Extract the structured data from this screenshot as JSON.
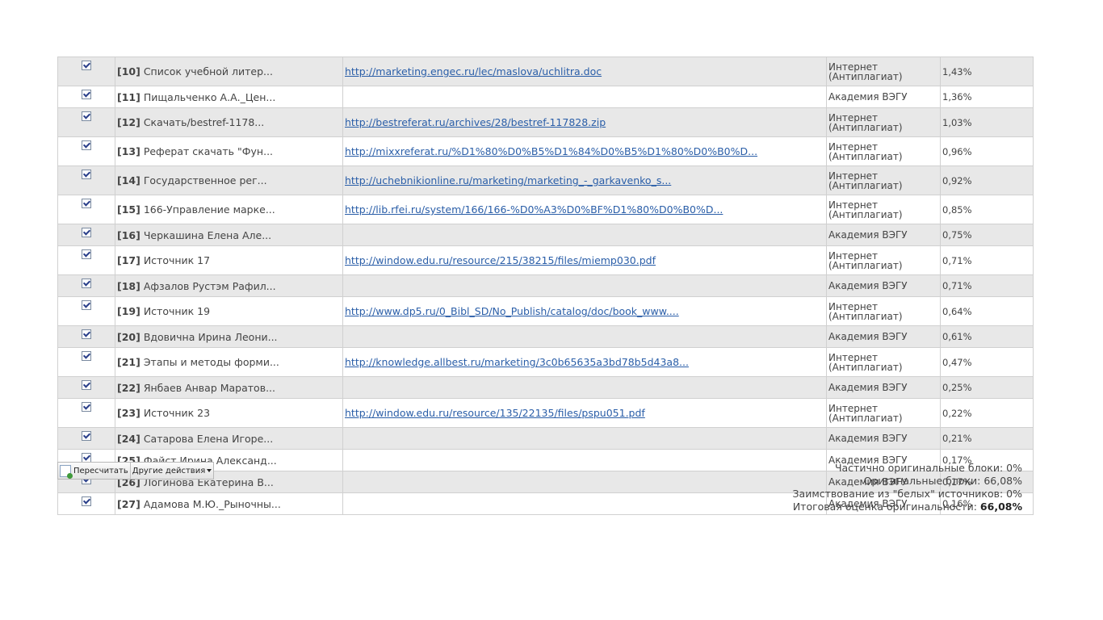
{
  "sources": [
    {
      "num": "[10]",
      "name": "Список учебной литер...",
      "url": "http://marketing.engec.ru/lec/maslova/uchlitra.doc",
      "db_line1": "Интернет",
      "db_line2": "(Антиплагиат)",
      "share": "1,43%"
    },
    {
      "num": "[11]",
      "name": "Пищальченко А.А._Цен...",
      "url": "",
      "db_line1": "Академия ВЭГУ",
      "db_line2": "",
      "share": "1,36%"
    },
    {
      "num": "[12]",
      "name": "Скачать/bestref-1178...",
      "url": "http://bestreferat.ru/archives/28/bestref-117828.zip",
      "db_line1": "Интернет",
      "db_line2": "(Антиплагиат)",
      "share": "1,03%"
    },
    {
      "num": "[13]",
      "name": "Реферат скачать \"Фун...",
      "url": "http://mixxreferat.ru/%D1%80%D0%B5%D1%84%D0%B5%D1%80%D0%B0%D...",
      "db_line1": "Интернет",
      "db_line2": "(Антиплагиат)",
      "share": "0,96%"
    },
    {
      "num": "[14]",
      "name": "Государственное рег...",
      "url": "http://uchebnikionline.ru/marketing/marketing_-_garkavenko_s...",
      "db_line1": "Интернет",
      "db_line2": "(Антиплагиат)",
      "share": "0,92%"
    },
    {
      "num": "[15]",
      "name": "166-Управление марке...",
      "url": "http://lib.rfei.ru/system/166/166-%D0%A3%D0%BF%D1%80%D0%B0%D...",
      "db_line1": "Интернет",
      "db_line2": "(Антиплагиат)",
      "share": "0,85%"
    },
    {
      "num": "[16]",
      "name": "Черкашина Елена Але...",
      "url": "",
      "db_line1": "Академия ВЭГУ",
      "db_line2": "",
      "share": "0,75%"
    },
    {
      "num": "[17]",
      "name": "Источник 17",
      "url": "http://window.edu.ru/resource/215/38215/files/miemp030.pdf",
      "db_line1": "Интернет",
      "db_line2": "(Антиплагиат)",
      "share": "0,71%"
    },
    {
      "num": "[18]",
      "name": "Афзалов Рустэм Рафил...",
      "url": "",
      "db_line1": "Академия ВЭГУ",
      "db_line2": "",
      "share": "0,71%"
    },
    {
      "num": "[19]",
      "name": "Источник 19",
      "url": "http://www.dp5.ru/0_Bibl_SD/No_Publish/catalog/doc/book_www....",
      "db_line1": "Интернет",
      "db_line2": "(Антиплагиат)",
      "share": "0,64%"
    },
    {
      "num": "[20]",
      "name": "Вдовична Ирина Леони...",
      "url": "",
      "db_line1": "Академия ВЭГУ",
      "db_line2": "",
      "share": "0,61%"
    },
    {
      "num": "[21]",
      "name": "Этапы и методы форми...",
      "url": "http://knowledge.allbest.ru/marketing/3c0b65635a3bd78b5d43a8...",
      "db_line1": "Интернет",
      "db_line2": "(Антиплагиат)",
      "share": "0,47%"
    },
    {
      "num": "[22]",
      "name": "Янбаев Анвар Маратов...",
      "url": "",
      "db_line1": "Академия ВЭГУ",
      "db_line2": "",
      "share": "0,25%"
    },
    {
      "num": "[23]",
      "name": "Источник 23",
      "url": "http://window.edu.ru/resource/135/22135/files/pspu051.pdf",
      "db_line1": "Интернет",
      "db_line2": "(Антиплагиат)",
      "share": "0,22%"
    },
    {
      "num": "[24]",
      "name": "Сатарова Елена Игоре...",
      "url": "",
      "db_line1": "Академия ВЭГУ",
      "db_line2": "",
      "share": "0,21%"
    },
    {
      "num": "[25]",
      "name": "Файст Ирина Александ...",
      "url": "",
      "db_line1": "Академия ВЭГУ",
      "db_line2": "",
      "share": "0,17%"
    },
    {
      "num": "[26]",
      "name": "Логинова Екатерина В...",
      "url": "",
      "db_line1": "Академия ВЭГУ",
      "db_line2": "",
      "share": "0,17%"
    },
    {
      "num": "[27]",
      "name": "Адамова М.Ю._Рыночны...",
      "url": "",
      "db_line1": "Академия ВЭГУ",
      "db_line2": "",
      "share": "0,16%"
    }
  ],
  "actions": {
    "recalc_label": "Пересчитать",
    "other_label": "Другие действия"
  },
  "summary": {
    "partial_label": "Частично оригинальные блоки:",
    "partial_value": "0%",
    "original_label": "Оригинальные блоки:",
    "original_value": "66,08%",
    "white_label": "Заимствование из \"белых\" источников:",
    "white_value": "0%",
    "total_label": "Итоговая оценка оригинальности:",
    "total_value": "66,08%"
  }
}
